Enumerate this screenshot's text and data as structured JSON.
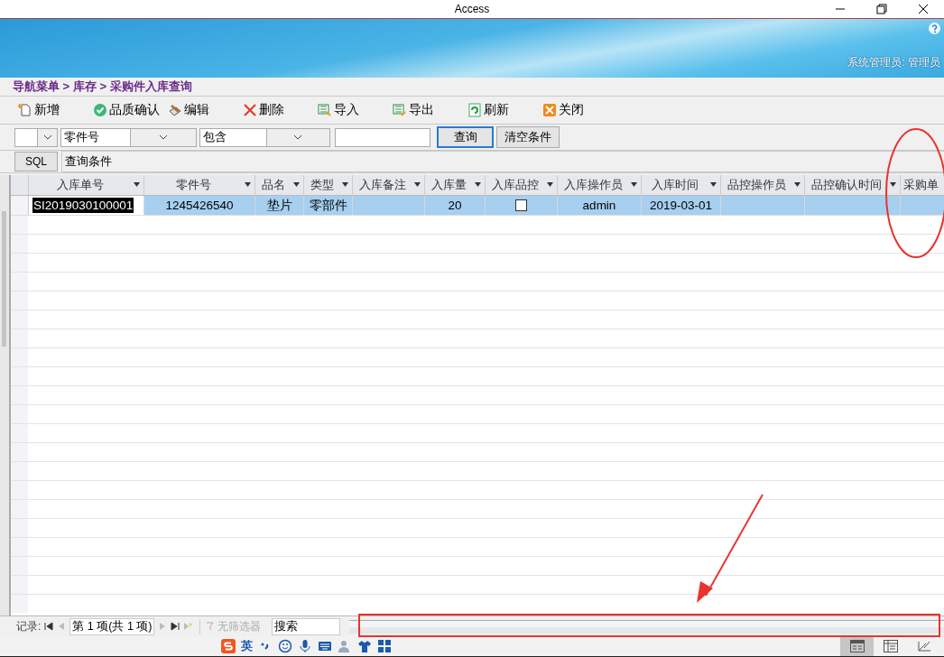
{
  "window": {
    "title": "Access"
  },
  "banner": {
    "user": "系统管理员: 管理员"
  },
  "breadcrumb": "导航菜单 > 库存 > 采购件入库查询",
  "toolbar": [
    {
      "label": "新增",
      "kind": "new"
    },
    {
      "label": "品质确认",
      "kind": "check"
    },
    {
      "label": "编辑",
      "kind": "edit"
    },
    {
      "label": "删除",
      "kind": "delete"
    },
    {
      "label": "导入",
      "kind": "import"
    },
    {
      "label": "导出",
      "kind": "export"
    },
    {
      "label": "刷新",
      "kind": "refresh"
    },
    {
      "label": "关闭",
      "kind": "close"
    }
  ],
  "filter": {
    "field": "零件号",
    "operator": "包含",
    "query_button": "查询",
    "clear_button": "清空条件"
  },
  "sql": {
    "button": "SQL",
    "value": "查询条件"
  },
  "table": {
    "columns": [
      "入库单号",
      "零件号",
      "品名",
      "类型",
      "入库备注",
      "入库量",
      "入库品控",
      "入库操作员",
      "入库时间",
      "品控操作员",
      "品控确认时间",
      "采购单"
    ],
    "rows": [
      {
        "selected": true,
        "cells": [
          "SI2019030100001",
          "1245426540",
          "垫片",
          "零部件",
          "",
          "20",
          null,
          "admin",
          "2019-03-01",
          "",
          "",
          ""
        ],
        "quality_checked": false
      }
    ]
  },
  "record_nav": {
    "label": "记录:",
    "position": "第 1 项(共 1 项)",
    "filter": "无筛选器",
    "search": "搜索"
  },
  "ime": {
    "mode": "英"
  },
  "views": [
    {
      "selected": true
    },
    {
      "selected": false
    },
    {
      "selected": false
    }
  ]
}
